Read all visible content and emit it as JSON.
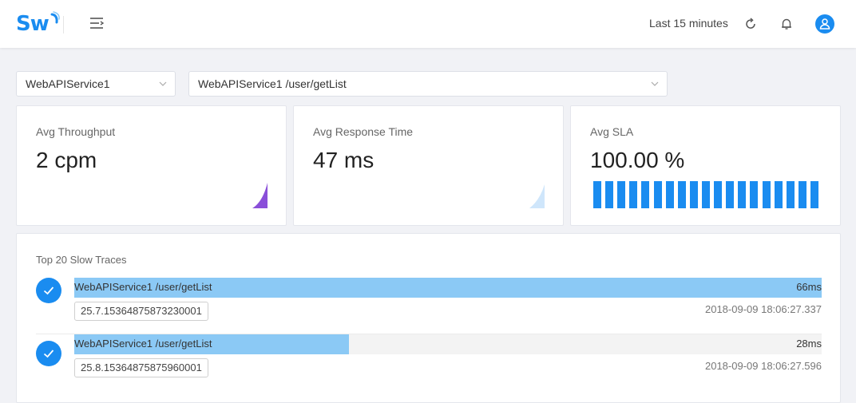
{
  "header": {
    "logo_text": "Sw",
    "time_range": "Last 15 minutes",
    "icons": [
      "menu-icon",
      "refresh-icon",
      "bell-icon",
      "user-icon"
    ],
    "accent_color": "#1a8cf0"
  },
  "filters": {
    "service": "WebAPIService1",
    "endpoint": "WebAPIService1 /user/getList"
  },
  "cards": [
    {
      "title": "Avg Throughput",
      "value": "2 cpm",
      "spark_color": "#8a4fd9"
    },
    {
      "title": "Avg Response Time",
      "value": "47 ms",
      "spark_color": "#cfe6fb"
    },
    {
      "title": "Avg SLA",
      "value": "100.00 %",
      "sla_bar_count": 19
    }
  ],
  "traces": {
    "title": "Top 20 Slow Traces",
    "items": [
      {
        "endpoint": "WebAPIService1 /user/getList",
        "duration": "66ms",
        "duration_ms": 66,
        "trace_id": "25.7.15364875873230001",
        "time": "2018-09-09 18:06:27.337"
      },
      {
        "endpoint": "WebAPIService1 /user/getList",
        "duration": "28ms",
        "duration_ms": 28,
        "trace_id": "25.8.15364875875960001",
        "time": "2018-09-09 18:06:27.596"
      }
    ]
  }
}
